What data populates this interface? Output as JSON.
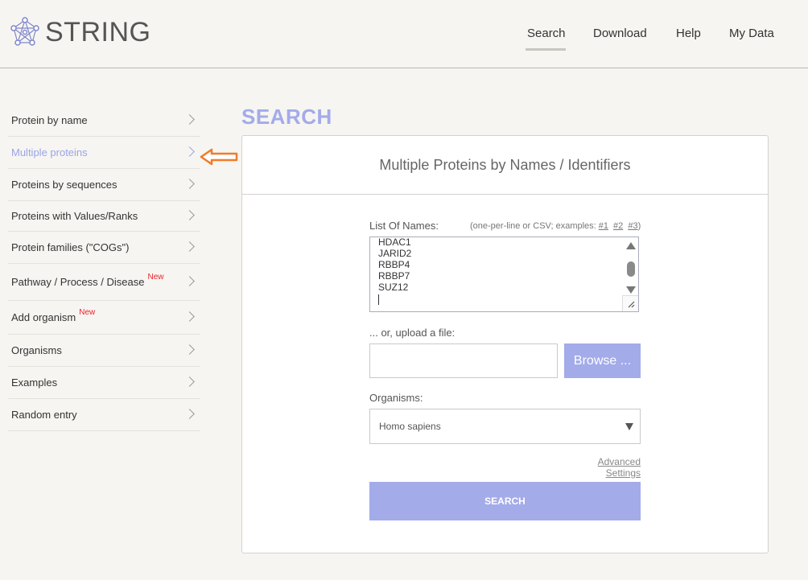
{
  "header": {
    "logo_text": "STRING",
    "nav": [
      "Search",
      "Download",
      "Help",
      "My Data"
    ],
    "active_nav": "Search"
  },
  "sidebar": {
    "items": [
      {
        "label": "Protein by name",
        "new": ""
      },
      {
        "label": "Multiple proteins",
        "new": ""
      },
      {
        "label": "Proteins by sequences",
        "new": ""
      },
      {
        "label": "Proteins with Values/Ranks",
        "new": ""
      },
      {
        "label": "Protein families (\"COGs\")",
        "new": ""
      },
      {
        "label": "Pathway / Process / Disease",
        "new": "New"
      },
      {
        "label": "Add organism",
        "new": "New"
      },
      {
        "label": "Organisms",
        "new": ""
      },
      {
        "label": "Examples",
        "new": ""
      },
      {
        "label": "Random entry",
        "new": ""
      }
    ],
    "active_index": 1
  },
  "main": {
    "title": "SEARCH",
    "panel_title": "Multiple Proteins by Names / Identifiers",
    "list_label": "List Of Names:",
    "list_hint": "(one-per-line or CSV; examples:",
    "examples": [
      "#1",
      "#2",
      "#3"
    ],
    "hint_close": ")",
    "list_lines": [
      "HDAC1",
      "JARID2",
      "RBBP4",
      "RBBP7",
      "SUZ12"
    ],
    "upload_label": "... or, upload a file:",
    "browse_label": "Browse ...",
    "organisms_label": "Organisms:",
    "organism_value": "Homo sapiens",
    "advanced_label": "Advanced Settings",
    "search_button": "SEARCH"
  },
  "colors": {
    "accent": "#a3abe9",
    "arrow": "#f07b2a",
    "new_badge": "#e8232a"
  },
  "icons": {
    "logo": "string-network-logo",
    "chevron": "chevron-right-icon",
    "annotation_arrow": "left-arrow-icon"
  }
}
